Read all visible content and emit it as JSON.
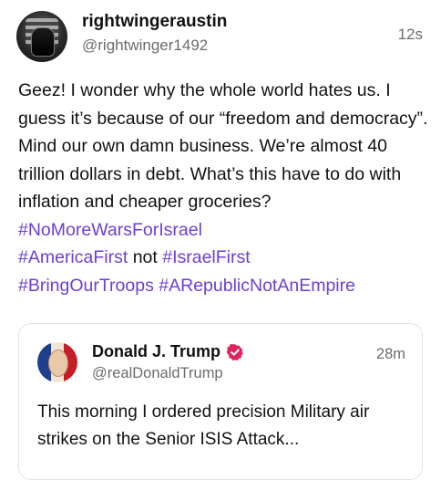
{
  "post": {
    "username": "rightwingeraustin",
    "handle": "@rightwinger1492",
    "time": "12s",
    "text_1": "Geez! I wonder why the whole world hates us. I guess it’s because of our “freedom and democracy”. Mind our own damn business. We’re almost 40 trillion dollars in debt. What’s this have to do with inflation and cheaper groceries? ",
    "tag_1": "#NoMoreWarsForIsrael",
    "tag_2": "#AmericaFirst",
    "text_not": " not ",
    "tag_3": "#IsraelFirst",
    "tag_4": "#BringOurTroops",
    "tag_5": "#ARepublicNotAnEmpire",
    "avatar_icon": "avatar-flag-helmet"
  },
  "quote": {
    "name": "Donald J. Trump",
    "handle": "@realDonaldTrump",
    "time": "28m",
    "text": "This morning I ordered precision Military air strikes on the Senior ISIS Attack...",
    "verified_icon": "verified-badge-icon",
    "verified_color": "#e0245e"
  },
  "colors": {
    "hashtag": "#6b3fd6",
    "secondary_text": "#6c6c6c"
  }
}
